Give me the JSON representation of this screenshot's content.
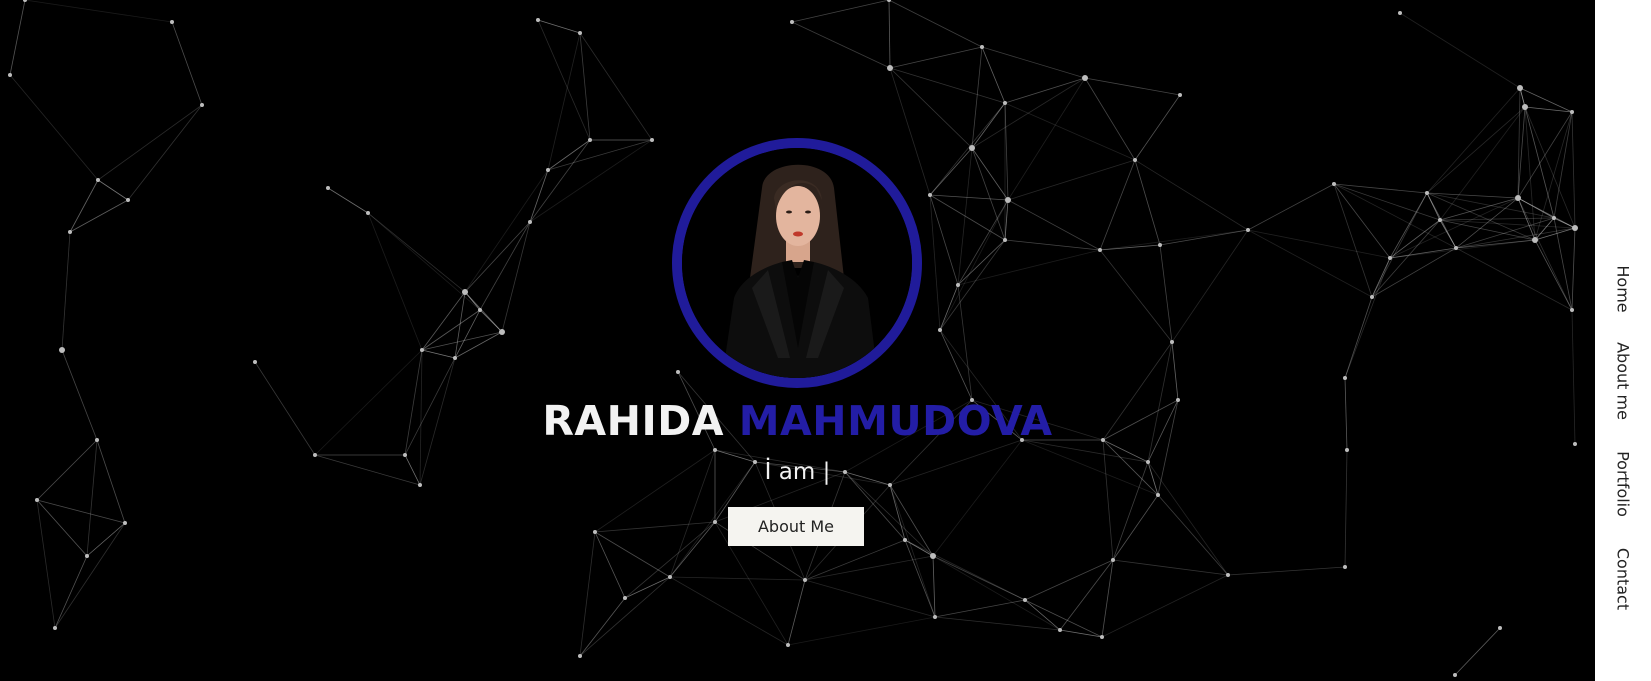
{
  "hero": {
    "first_name": "RAHIDA",
    "last_name": "MAHMUDOVA",
    "tagline": "İ am |",
    "about_button": "About Me",
    "accent_color": "#231da6",
    "background": "particle network on black"
  },
  "nav": {
    "items": [
      {
        "label": "Home"
      },
      {
        "label": "About me"
      },
      {
        "label": "Portfolio"
      },
      {
        "label": "Contact"
      }
    ]
  },
  "icons": [
    "profile-photo"
  ]
}
